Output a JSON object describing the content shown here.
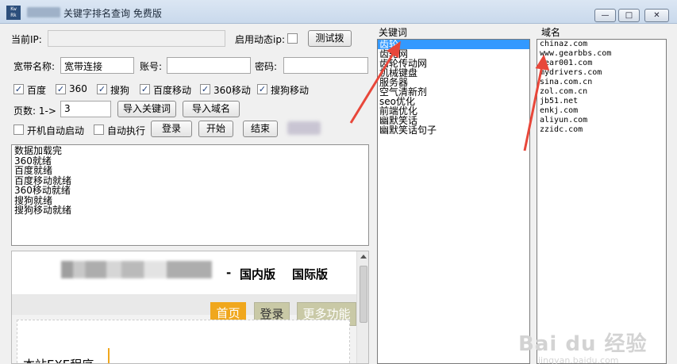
{
  "window": {
    "title": "关键字排名查询 免费版",
    "icon_text": "Kw Rk",
    "controls": {
      "minimize": "—",
      "maximize": "□",
      "close": "✕"
    }
  },
  "form": {
    "current_ip_label": "当前IP:",
    "current_ip_value": "",
    "dynamic_ip_label": "启用动态ip:",
    "dynamic_ip_checked": false,
    "test_dial_button": "测试拨",
    "broadband_label": "宽带名称:",
    "broadband_value": "宽带连接",
    "account_label": "账号:",
    "account_value": "",
    "password_label": "密码:",
    "password_value": "",
    "engines": [
      {
        "label": "百度",
        "checked": true
      },
      {
        "label": "360",
        "checked": true
      },
      {
        "label": "搜狗",
        "checked": true
      },
      {
        "label": "百度移动",
        "checked": true
      },
      {
        "label": "360移动",
        "checked": true
      },
      {
        "label": "搜狗移动",
        "checked": true
      }
    ],
    "pages_label": "页数: 1->",
    "pages_value": "3",
    "import_keywords_button": "导入关键词",
    "import_domains_button": "导入域名",
    "autostart_label": "开机自动启动",
    "autostart_checked": false,
    "autorun_label": "自动执行",
    "autorun_checked": false,
    "login_button": "登录",
    "start_button": "开始",
    "stop_button": "结束"
  },
  "log": {
    "lines": [
      "数据加载完",
      "360就绪",
      "百度就绪",
      "百度移动就绪",
      "360移动就绪",
      "搜狗就绪",
      "搜狗移动就绪"
    ]
  },
  "web": {
    "dash": "-",
    "version_cn": "国内版",
    "version_intl": "国际版",
    "nav_home": "首页",
    "nav_login": "登录",
    "nav_more": "更多功能",
    "card_title": "本站EXE程序"
  },
  "keywords": {
    "label": "关键词",
    "items": [
      "齿轮",
      "齿轮网",
      "齿轮传动网",
      "机械键盘",
      "服务器",
      "空气清新剂",
      "seo优化",
      "前端优化",
      "幽默笑话",
      "幽默笑话句子"
    ],
    "selected_index": 0
  },
  "domains": {
    "label": "域名",
    "items": [
      "chinaz.com",
      "www.gearbbs.com",
      "gear001.com",
      "mydrivers.com",
      "sina.com.cn",
      "zol.com.cn",
      "jb51.net",
      "enkj.com",
      "aliyun.com",
      "zzidc.com"
    ]
  },
  "watermark": {
    "main": "Bai du 经验",
    "sub": "jingyan.baidu.com"
  },
  "colors": {
    "selection": "#3399ff",
    "nav_home": "#f0a71d",
    "nav_secondary": "#c9c9a6",
    "annotation_arrow": "#e8473a"
  }
}
